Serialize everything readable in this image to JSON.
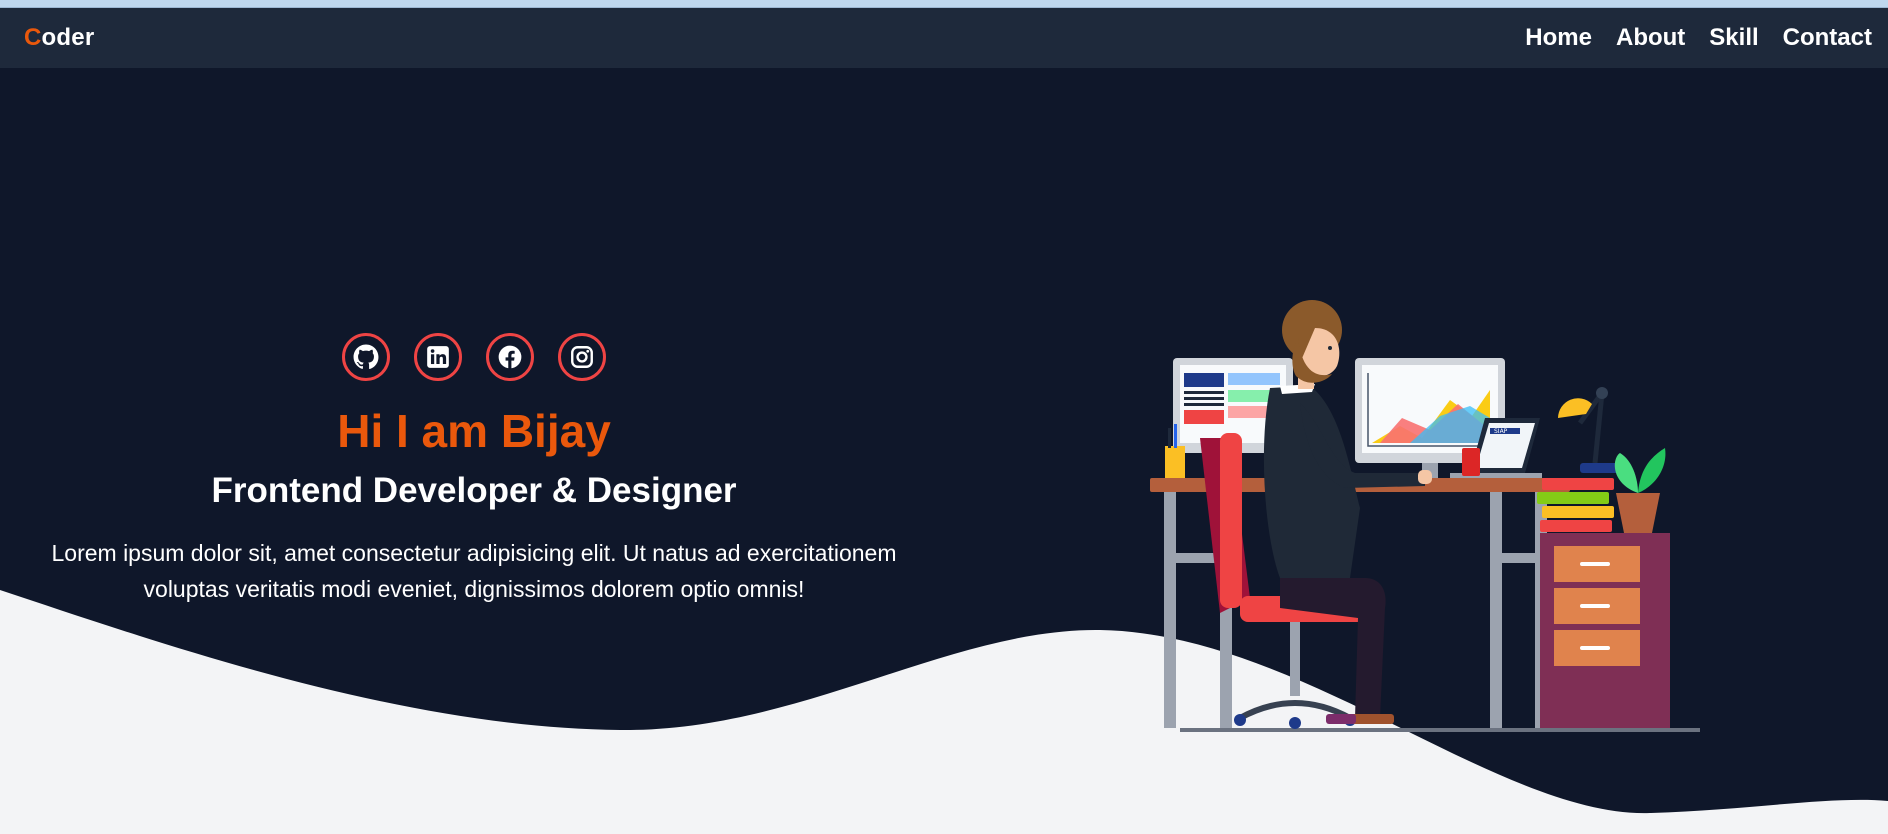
{
  "topbar": {
    "logo_first": "C",
    "logo_rest": "oder",
    "nav": [
      {
        "label": "Home"
      },
      {
        "label": "About"
      },
      {
        "label": "Skill"
      },
      {
        "label": "Contact"
      }
    ]
  },
  "hero": {
    "title": "Hi I am Bijay",
    "subtitle": "Frontend Developer & Designer",
    "description": "Lorem ipsum dolor sit, amet consectetur adipisicing elit. Ut natus ad exercitationem voluptas veritatis modi eveniet, dignissimos dolorem optio omnis!",
    "socials": [
      {
        "icon": "github-icon"
      },
      {
        "icon": "linkedin-icon"
      },
      {
        "icon": "facebook-icon"
      },
      {
        "icon": "instagram-icon"
      }
    ],
    "illustration_laptop_text": "SIAP"
  },
  "colors": {
    "navbar_bg": "#1e293b",
    "hero_bg": "#0f172a",
    "accent": "#ea580c",
    "social_border": "#ef4444",
    "page_bg": "#f3f4f6"
  }
}
